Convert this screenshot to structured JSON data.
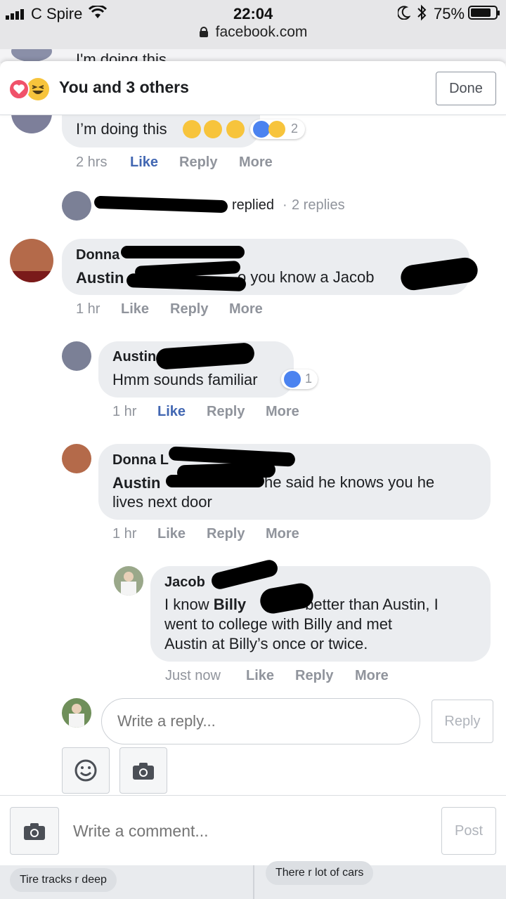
{
  "status": {
    "carrier": "C Spire",
    "time": "22:04",
    "battery": "75%",
    "url": "facebook.com"
  },
  "ghost": {
    "text": "I'm doing this"
  },
  "header": {
    "title": "You and 3 others",
    "done_label": "Done"
  },
  "comments": [
    {
      "text": "I’m doing this",
      "reaction_count": "2",
      "time": "2 hrs",
      "like": "Like",
      "reply": "Reply",
      "more": "More"
    }
  ],
  "replies_summary": {
    "replied": "replied",
    "dot": "·",
    "count": "2 replies"
  },
  "donna1": {
    "name": "Donna",
    "mention": "Austin",
    "text": "o you know a Jacob",
    "time": "1 hr",
    "like": "Like",
    "reply": "Reply",
    "more": "More"
  },
  "austin": {
    "name": "Austin",
    "text": "Hmm sounds familiar",
    "reaction_count": "1",
    "time": "1 hr",
    "like": "Like",
    "reply": "Reply",
    "more": "More"
  },
  "donna2": {
    "name": "Donna L",
    "mention": "Austin",
    "text_line1": "he said he knows you he",
    "text_line2": "lives next door",
    "time": "1 hr",
    "like": "Like",
    "reply": "Reply",
    "more": "More"
  },
  "jacob": {
    "name": "Jacob",
    "line1_pre": "I know ",
    "line1_bold": "Billy",
    "line1_post": "better than Austin, I",
    "line2": "went to college with Billy and met",
    "line3": "Austin at Billy’s once or twice.",
    "time": "Just now",
    "like": "Like",
    "reply": "Reply",
    "more": "More"
  },
  "reply_composer": {
    "placeholder": "Write a reply...",
    "button": "Reply"
  },
  "comment_composer": {
    "placeholder": "Write a comment...",
    "button": "Post"
  },
  "feed_preview": {
    "left": "Tire tracks r deep",
    "right": "There r lot of cars"
  },
  "colors": {
    "facebook_blue": "#4267b2",
    "like_blue": "#4b83f0",
    "bubble_gray": "#ebedf0",
    "meta_gray": "#90949c",
    "love_red": "#f0526a",
    "haha_yellow": "#f7c43c"
  }
}
